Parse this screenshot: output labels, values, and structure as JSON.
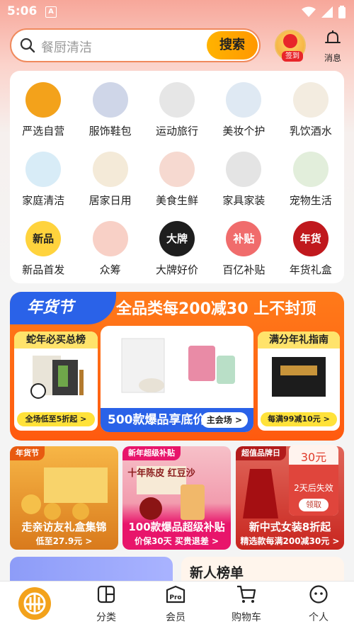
{
  "status": {
    "time": "5:06",
    "notify_icon": "A"
  },
  "search": {
    "placeholder": "餐厨清洁",
    "button": "搜索"
  },
  "header": {
    "signin_label": "签到",
    "message_label": "消息"
  },
  "categories": [
    {
      "label": "严选自营",
      "icon": "yanxuan-logo-icon"
    },
    {
      "label": "服饰鞋包",
      "icon": "shirt-shoes-icon"
    },
    {
      "label": "运动旅行",
      "icon": "luggage-ball-icon"
    },
    {
      "label": "美妆个护",
      "icon": "cosmetics-icon"
    },
    {
      "label": "乳饮酒水",
      "icon": "drinks-icon"
    },
    {
      "label": "家庭清洁",
      "icon": "cleaning-icon"
    },
    {
      "label": "居家日用",
      "icon": "household-icon"
    },
    {
      "label": "美食生鲜",
      "icon": "fresh-food-icon"
    },
    {
      "label": "家具家装",
      "icon": "chair-icon"
    },
    {
      "label": "宠物生活",
      "icon": "pet-food-icon"
    },
    {
      "label": "新品首发",
      "icon": "new-product-icon",
      "badge": "新品"
    },
    {
      "label": "众筹",
      "icon": "crowdfunding-icon"
    },
    {
      "label": "大牌好价",
      "icon": "big-brand-icon",
      "badge": "大牌"
    },
    {
      "label": "百亿补贴",
      "icon": "subsidy-icon",
      "badge": "补贴"
    },
    {
      "label": "年货礼盒",
      "icon": "gift-box-icon",
      "badge": "年货"
    }
  ],
  "promo": {
    "tab": "年货节",
    "headline": "全品类每200减30 上不封顶",
    "left_title": "蛇年必买总榜",
    "left_foot": "全场低至5折起 >",
    "mid_caption": "500款爆品享底价!",
    "mid_button": "主会场 >",
    "right_title": "满分年礼指南",
    "right_foot": "每满99减10元 >"
  },
  "tiles": [
    {
      "tag": "年货节",
      "title": "走亲访友礼盒集锦",
      "sub": "低至27.9元 >"
    },
    {
      "tag": "新年超级补贴",
      "title": "100款爆品超级补贴",
      "sub": "价保30天 买贵退差 >",
      "product_text": "十年陈皮 红豆沙"
    },
    {
      "tag": "超值品牌日",
      "title": "新中式女装8折起",
      "sub": "精选款每满200减30元 >"
    }
  ],
  "coupon": {
    "amount": "30元",
    "expire": "2天后失效",
    "button": "领取"
  },
  "lower": {
    "right_title": "新人榜单"
  },
  "tabbar": [
    {
      "label": "分类"
    },
    {
      "label": "会员"
    },
    {
      "label": "购物车"
    },
    {
      "label": "个人"
    }
  ],
  "colors": {
    "accent": "#ff9800",
    "promo_orange": "#ff5a0f",
    "promo_blue": "#2a62e8",
    "brand_gold": "#f3a21b"
  }
}
